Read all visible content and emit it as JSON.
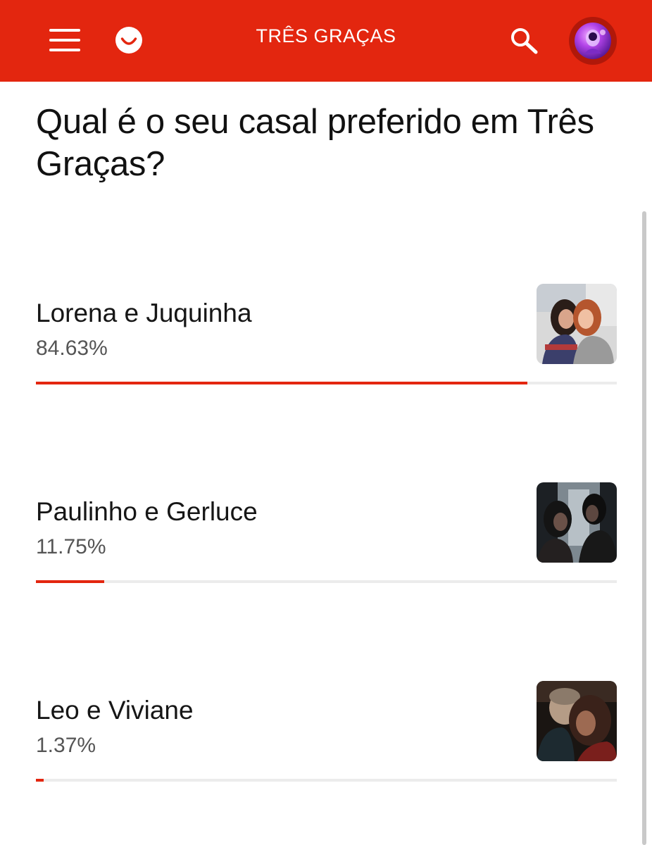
{
  "header": {
    "title": "TRÊS GRAÇAS",
    "menu_icon": "hamburger-menu-icon",
    "logo_icon": "smile-logo-icon",
    "search_icon": "search-icon",
    "avatar": "user-avatar"
  },
  "colors": {
    "brand": "#e3260f",
    "bar_track": "#ececec",
    "text": "#111111",
    "muted": "#555555"
  },
  "poll": {
    "question": "Qual é o seu casal preferido em Três Graças?",
    "options": [
      {
        "label": "Lorena e Juquinha",
        "percent_text": "84.63%",
        "percent": 84.63
      },
      {
        "label": "Paulinho e Gerluce",
        "percent_text": "11.75%",
        "percent": 11.75
      },
      {
        "label": "Leo e Viviane",
        "percent_text": "1.37%",
        "percent": 1.37
      }
    ]
  }
}
